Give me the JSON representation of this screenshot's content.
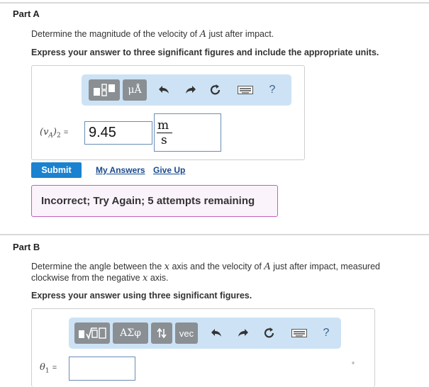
{
  "partA": {
    "title": "Part A",
    "prompt_pre": "Determine the magnitude of the velocity of ",
    "prompt_var": "A",
    "prompt_post": " just after impact.",
    "instruction": "Express your answer to three significant figures and include the appropriate units.",
    "toolbar": {
      "units_button": "μÅ",
      "help": "?"
    },
    "answer_label": "(vA)2 =",
    "answer_value": "9.45",
    "unit_numerator": "m",
    "unit_denominator": "s",
    "submit": "Submit",
    "my_answers": "My Answers",
    "give_up": "Give Up",
    "feedback": "Incorrect; Try Again; 5 attempts remaining"
  },
  "partB": {
    "title": "Part B",
    "prompt_l1_pre": "Determine the angle between the ",
    "prompt_l1_var1": "x",
    "prompt_l1_mid": " axis and the velocity of ",
    "prompt_l1_var2": "A",
    "prompt_l1_post": " just after impact, measured",
    "prompt_l2_pre": "clockwise from the negative ",
    "prompt_l2_var": "x",
    "prompt_l2_post": " axis.",
    "instruction": "Express your answer using three significant figures.",
    "toolbar": {
      "greek_button": "ΑΣφ",
      "vec_button": "vec",
      "help": "?"
    },
    "answer_label": "θ1 =",
    "answer_value": "",
    "degree_symbol": "°"
  }
}
